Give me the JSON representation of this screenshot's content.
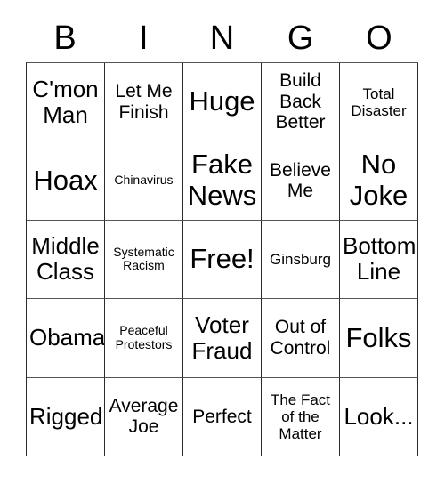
{
  "card": {
    "header": {
      "letters": [
        "B",
        "I",
        "N",
        "G",
        "O"
      ]
    },
    "rows": [
      [
        {
          "text": "C'mon Man",
          "size": "lg"
        },
        {
          "text": "Let Me Finish",
          "size": "md"
        },
        {
          "text": "Huge",
          "size": "xl"
        },
        {
          "text": "Build Back Better",
          "size": "md"
        },
        {
          "text": "Total Disaster",
          "size": "sm"
        }
      ],
      [
        {
          "text": "Hoax",
          "size": "xl"
        },
        {
          "text": "Chinavirus",
          "size": "xs"
        },
        {
          "text": "Fake News",
          "size": "xl"
        },
        {
          "text": "Believe Me",
          "size": "md"
        },
        {
          "text": "No Joke",
          "size": "xl"
        }
      ],
      [
        {
          "text": "Middle Class",
          "size": "lg"
        },
        {
          "text": "Systematic Racism",
          "size": "xs"
        },
        {
          "text": "Free!",
          "size": "xl"
        },
        {
          "text": "Ginsburg",
          "size": "sm"
        },
        {
          "text": "Bottom Line",
          "size": "lg"
        }
      ],
      [
        {
          "text": "Obama",
          "size": "lg"
        },
        {
          "text": "Peaceful Protestors",
          "size": "xs"
        },
        {
          "text": "Voter Fraud",
          "size": "lg"
        },
        {
          "text": "Out of Control",
          "size": "md"
        },
        {
          "text": "Folks",
          "size": "xl"
        }
      ],
      [
        {
          "text": "Rigged",
          "size": "lg"
        },
        {
          "text": "Average Joe",
          "size": "md"
        },
        {
          "text": "Perfect",
          "size": "md"
        },
        {
          "text": "The Fact of the Matter",
          "size": "sm"
        },
        {
          "text": "Look...",
          "size": "lg"
        }
      ]
    ]
  }
}
